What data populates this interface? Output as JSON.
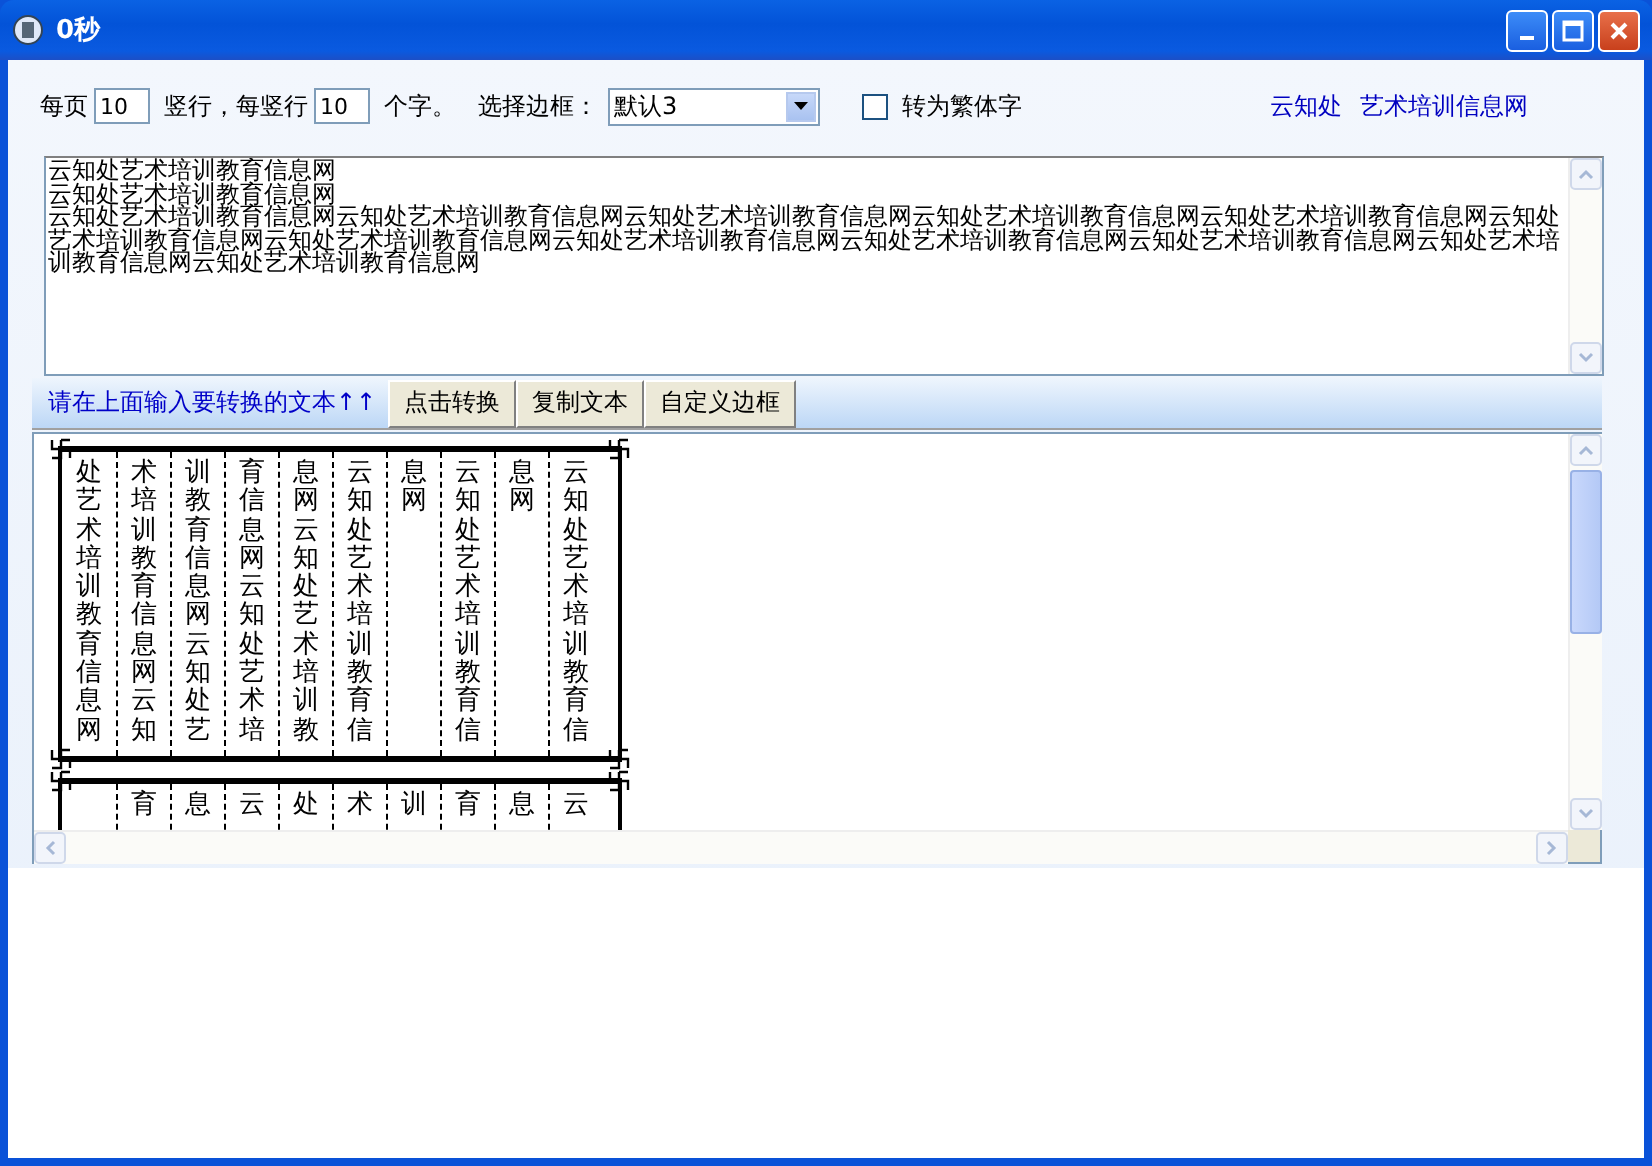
{
  "window": {
    "title": "0秒"
  },
  "options": {
    "pages_label": "每页",
    "columns_per_page": "10",
    "columns_label": "竖行，每竖行",
    "chars_per_column": "10",
    "chars_label": "个字。",
    "border_label": "选择边框：",
    "border_value": "默认3",
    "traditional": {
      "label": "转为繁体字",
      "checked": false
    },
    "links": [
      "云知处",
      "艺术培训信息网"
    ]
  },
  "source": {
    "lines": [
      "云知处艺术培训教育信息网",
      "云知处艺术培训教育信息网",
      "云知处艺术培训教育信息网云知处艺术培训教育信息网云知处艺术培训教育信息网云知处艺术培训教育信息网云知处艺术培训教育信息网云知处艺术培训教育信息网云知处艺术培训教育信息网云知处艺术培训教育信息网云知处艺术培训教育信息网云知处艺术培训教育信息网云知处艺术培训教育信息网云知处艺术培训教育信息网"
    ]
  },
  "actions": {
    "hint": "请在上面输入要转换的文本↑↑",
    "buttons": [
      "点击转换",
      "复制文本",
      "自定义边框"
    ]
  },
  "output": {
    "pages": [
      {
        "columns": [
          "处艺术培训教育信息网",
          "术培训教育信息网云知",
          "训教育信息网云知处艺",
          "育信息网云知处艺术培",
          "息网云知处艺术培训教",
          "云知处艺术培训教育信",
          "息网",
          "云知处艺术培训教育信",
          "息网",
          "云知处艺术培训教育信"
        ]
      },
      {
        "columns": [
          "育",
          "息",
          "云",
          "处",
          "术",
          "训",
          "育",
          "息",
          "云"
        ]
      }
    ]
  }
}
